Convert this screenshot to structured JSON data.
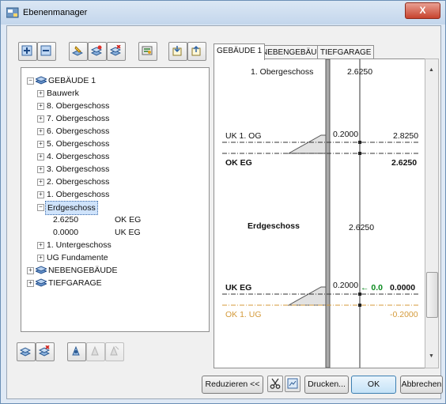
{
  "window": {
    "title": "Ebenenmanager",
    "close_glyph": "X"
  },
  "toolbar": {
    "icons": [
      "add-icon",
      "remove-icon",
      "layer-edit-icon",
      "layer-add-icon",
      "layer-delete-icon",
      "settings-icon",
      "import-icon",
      "export-icon"
    ]
  },
  "tree": {
    "root": "GEBÄUDE 1",
    "items": [
      {
        "label": "Bauwerk"
      },
      {
        "label": "8. Obergeschoss"
      },
      {
        "label": "7. Obergeschoss"
      },
      {
        "label": "6. Obergeschoss"
      },
      {
        "label": "5. Obergeschoss"
      },
      {
        "label": "4. Obergeschoss"
      },
      {
        "label": "3. Obergeschoss"
      },
      {
        "label": "2. Obergeschoss"
      },
      {
        "label": "1. Obergeschoss"
      },
      {
        "label": "Erdgeschoss"
      }
    ],
    "children": [
      {
        "value": "2.6250",
        "name": "OK EG"
      },
      {
        "value": "0.0000",
        "name": "UK EG"
      }
    ],
    "after_items": [
      {
        "label": "1. Untergeschoss"
      },
      {
        "label": "UG Fundamente"
      }
    ],
    "roots2": [
      "NEBENGEBÄUDE",
      "TIEFGARAGE"
    ],
    "expander_plus": "+",
    "expander_minus": "−"
  },
  "tabs": [
    "GEBÄUDE 1",
    "NEBENGEBÄUDE",
    "TIEFGARAGE"
  ],
  "diagram": {
    "floor_above": "1. Obergeschoss",
    "floor_above_height": "2.6250",
    "uk_og_label": "UK 1. OG",
    "uk_og_thickness": "0.2000",
    "uk_og_level": "2.8250",
    "ok_eg_label": "OK EG",
    "ok_eg_level": "2.6250",
    "floor_name": "Erdgeschoss",
    "floor_height": "2.6250",
    "uk_eg_label": "UK EG",
    "uk_eg_thickness": "0.2000",
    "uk_eg_offset": "← 0.0",
    "uk_eg_level": "0.0000",
    "ok_ug_label": "OK 1. UG",
    "ok_ug_level": "-0.2000",
    "colors": {
      "green": "#0a8a1e",
      "orange": "#d49a3a"
    }
  },
  "footer": {
    "reduce": "Reduzieren <<",
    "print": "Drucken...",
    "ok": "OK",
    "cancel": "Abbrechen"
  }
}
